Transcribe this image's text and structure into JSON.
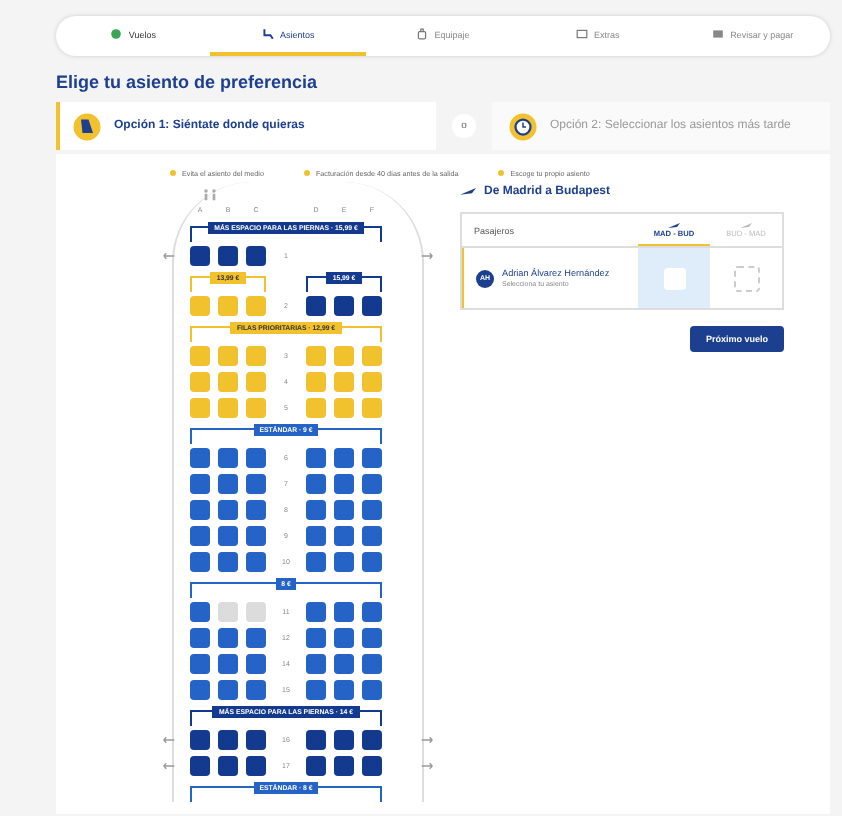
{
  "steps": [
    {
      "label": "Vuelos",
      "done": true,
      "selected": false
    },
    {
      "label": "Asientos",
      "done": false,
      "selected": true
    },
    {
      "label": "Equipaje",
      "done": false,
      "selected": false
    },
    {
      "label": "Extras",
      "done": false,
      "selected": false
    },
    {
      "label": "Revisar y pagar",
      "done": false,
      "selected": false
    }
  ],
  "title": "Elige tu asiento de preferencia",
  "options": [
    {
      "label": "Opción 1: Siéntate donde quieras",
      "selected": true
    },
    {
      "label": "Opción 2: Seleccionar los asientos más tarde",
      "selected": false
    }
  ],
  "options_separator": "o",
  "legend": [
    "Evita el asiento del medio",
    "Facturación desde 40 días antes de la salida",
    "Escoge tu propio asiento"
  ],
  "seat_map": {
    "columns": [
      "A",
      "B",
      "C",
      "D",
      "E",
      "F"
    ],
    "blocks": [
      {
        "kind": "banners",
        "items": [
          {
            "label": "MÁS ESPACIO PARA LAS PIERNAS · 15,99 €",
            "kind": "xl",
            "left": true,
            "right": true
          }
        ]
      },
      {
        "kind": "row",
        "number": "1",
        "exit": true,
        "left": {
          "kind": "xl",
          "taken": [
            false,
            false,
            false
          ]
        }
      },
      {
        "kind": "banners",
        "items": [
          {
            "label": "13,99 €",
            "kind": "priority",
            "left": true,
            "right": false
          },
          {
            "label": "15,99 €",
            "kind": "xl",
            "left": false,
            "right": true
          }
        ]
      },
      {
        "kind": "row",
        "number": "2",
        "exit": false,
        "left": {
          "kind": "priority",
          "taken": [
            false,
            false,
            false
          ]
        },
        "right": {
          "kind": "xl",
          "taken": [
            false,
            false,
            false
          ]
        }
      },
      {
        "kind": "banners",
        "items": [
          {
            "label": "FILAS PRIORITARIAS · 12,99 €",
            "kind": "priority",
            "left": true,
            "right": true
          }
        ]
      },
      {
        "kind": "row",
        "number": "3",
        "exit": false,
        "left": {
          "kind": "priority",
          "taken": [
            false,
            false,
            false
          ]
        },
        "right": {
          "kind": "priority",
          "taken": [
            false,
            false,
            false
          ]
        }
      },
      {
        "kind": "row",
        "number": "4",
        "exit": false,
        "left": {
          "kind": "priority",
          "taken": [
            false,
            false,
            false
          ]
        },
        "right": {
          "kind": "priority",
          "taken": [
            false,
            false,
            false
          ]
        }
      },
      {
        "kind": "row",
        "number": "5",
        "exit": false,
        "left": {
          "kind": "priority",
          "taken": [
            false,
            false,
            false
          ]
        },
        "right": {
          "kind": "priority",
          "taken": [
            false,
            false,
            false
          ]
        }
      },
      {
        "kind": "banners",
        "items": [
          {
            "label": "ESTÁNDAR · 9 €",
            "kind": "standard",
            "left": true,
            "right": true
          }
        ]
      },
      {
        "kind": "row",
        "number": "6",
        "exit": false,
        "left": {
          "kind": "standard",
          "taken": [
            false,
            false,
            false
          ]
        },
        "right": {
          "kind": "standard",
          "taken": [
            false,
            false,
            false
          ]
        }
      },
      {
        "kind": "row",
        "number": "7",
        "exit": false,
        "left": {
          "kind": "standard",
          "taken": [
            false,
            false,
            false
          ]
        },
        "right": {
          "kind": "standard",
          "taken": [
            false,
            false,
            false
          ]
        }
      },
      {
        "kind": "row",
        "number": "8",
        "exit": false,
        "left": {
          "kind": "standard",
          "taken": [
            false,
            false,
            false
          ]
        },
        "right": {
          "kind": "standard",
          "taken": [
            false,
            false,
            false
          ]
        }
      },
      {
        "kind": "row",
        "number": "9",
        "exit": false,
        "left": {
          "kind": "standard",
          "taken": [
            false,
            false,
            false
          ]
        },
        "right": {
          "kind": "standard",
          "taken": [
            false,
            false,
            false
          ]
        }
      },
      {
        "kind": "row",
        "number": "10",
        "exit": false,
        "left": {
          "kind": "standard",
          "taken": [
            false,
            false,
            false
          ]
        },
        "right": {
          "kind": "standard",
          "taken": [
            false,
            false,
            false
          ]
        }
      },
      {
        "kind": "banners",
        "items": [
          {
            "label": "8 €",
            "kind": "standard",
            "left": true,
            "right": true
          }
        ]
      },
      {
        "kind": "row",
        "number": "11",
        "exit": false,
        "left": {
          "kind": "standard",
          "taken": [
            false,
            true,
            true
          ]
        },
        "right": {
          "kind": "standard",
          "taken": [
            false,
            false,
            false
          ]
        }
      },
      {
        "kind": "row",
        "number": "12",
        "exit": false,
        "left": {
          "kind": "standard",
          "taken": [
            false,
            false,
            false
          ]
        },
        "right": {
          "kind": "standard",
          "taken": [
            false,
            false,
            false
          ]
        }
      },
      {
        "kind": "row",
        "number": "14",
        "exit": false,
        "left": {
          "kind": "standard",
          "taken": [
            false,
            false,
            false
          ]
        },
        "right": {
          "kind": "standard",
          "taken": [
            false,
            false,
            false
          ]
        }
      },
      {
        "kind": "row",
        "number": "15",
        "exit": false,
        "left": {
          "kind": "standard",
          "taken": [
            false,
            false,
            false
          ]
        },
        "right": {
          "kind": "standard",
          "taken": [
            false,
            false,
            false
          ]
        }
      },
      {
        "kind": "banners",
        "items": [
          {
            "label": "MÁS ESPACIO PARA LAS PIERNAS · 14 €",
            "kind": "xl",
            "left": true,
            "right": true
          }
        ]
      },
      {
        "kind": "row",
        "number": "16",
        "exit": true,
        "left": {
          "kind": "xl",
          "taken": [
            false,
            false,
            false
          ]
        },
        "right": {
          "kind": "xl",
          "taken": [
            false,
            false,
            false
          ]
        }
      },
      {
        "kind": "row",
        "number": "17",
        "exit": true,
        "left": {
          "kind": "xl",
          "taken": [
            false,
            false,
            false
          ]
        },
        "right": {
          "kind": "xl",
          "taken": [
            false,
            false,
            false
          ]
        }
      },
      {
        "kind": "banners",
        "items": [
          {
            "label": "ESTÁNDAR · 8 €",
            "kind": "standard",
            "left": true,
            "right": true
          }
        ]
      }
    ]
  },
  "trip": {
    "title": "De Madrid a Budapest",
    "header": "Pasajeros",
    "flights": [
      {
        "label": "MAD - BUD",
        "selected": true
      },
      {
        "label": "BUD - MAD",
        "selected": false
      }
    ],
    "passengers": [
      {
        "initials": "AH",
        "name": "Adrian Álvarez Hernández",
        "hint": "Selecciona tu asiento"
      }
    ],
    "next_button": "Próximo vuelo"
  }
}
